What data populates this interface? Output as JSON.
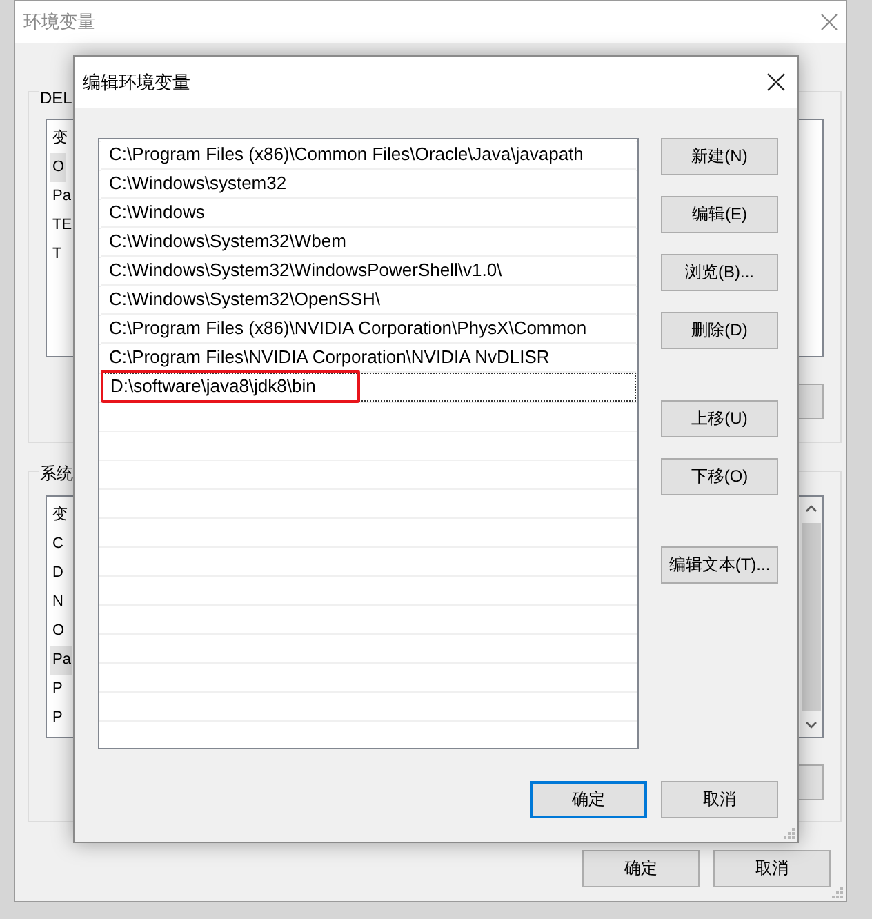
{
  "background_window": {
    "title": "环境变量",
    "user_group": {
      "label": "DEL",
      "header": "变",
      "rows": [
        {
          "text": "O",
          "selected": true
        },
        {
          "text": "Pa",
          "selected": false
        },
        {
          "text": "TE",
          "selected": false
        },
        {
          "text": "T",
          "selected": false
        }
      ]
    },
    "system_group": {
      "label": "系统",
      "header": "变",
      "rows": [
        {
          "text": "C",
          "selected": false
        },
        {
          "text": "D",
          "selected": false
        },
        {
          "text": "N",
          "selected": false
        },
        {
          "text": "O",
          "selected": false
        },
        {
          "text": "Pa",
          "selected": true
        },
        {
          "text": "P",
          "selected": false
        },
        {
          "text": "P",
          "selected": false
        }
      ]
    },
    "buttons": [
      "确定",
      "取消"
    ]
  },
  "dialog": {
    "title": "编辑环境变量",
    "paths": [
      {
        "text": "C:\\Program Files (x86)\\Common Files\\Oracle\\Java\\javapath",
        "selected": false,
        "highlighted": false
      },
      {
        "text": "C:\\Windows\\system32",
        "selected": false,
        "highlighted": false
      },
      {
        "text": "C:\\Windows",
        "selected": false,
        "highlighted": false
      },
      {
        "text": "C:\\Windows\\System32\\Wbem",
        "selected": false,
        "highlighted": false
      },
      {
        "text": "C:\\Windows\\System32\\WindowsPowerShell\\v1.0\\",
        "selected": false,
        "highlighted": false
      },
      {
        "text": "C:\\Windows\\System32\\OpenSSH\\",
        "selected": false,
        "highlighted": false
      },
      {
        "text": "C:\\Program Files (x86)\\NVIDIA Corporation\\PhysX\\Common",
        "selected": false,
        "highlighted": false
      },
      {
        "text": "C:\\Program Files\\NVIDIA Corporation\\NVIDIA NvDLISR",
        "selected": false,
        "highlighted": false
      },
      {
        "text": "D:\\software\\java8\\jdk8\\bin",
        "selected": true,
        "highlighted": true
      }
    ],
    "side_button_groups": [
      [
        "新建(N)",
        "编辑(E)",
        "浏览(B)...",
        "删除(D)"
      ],
      [
        "上移(U)",
        "下移(O)"
      ],
      [
        "编辑文本(T)..."
      ]
    ],
    "buttons": [
      {
        "label": "确定",
        "default": true
      },
      {
        "label": "取消",
        "default": false
      }
    ]
  }
}
